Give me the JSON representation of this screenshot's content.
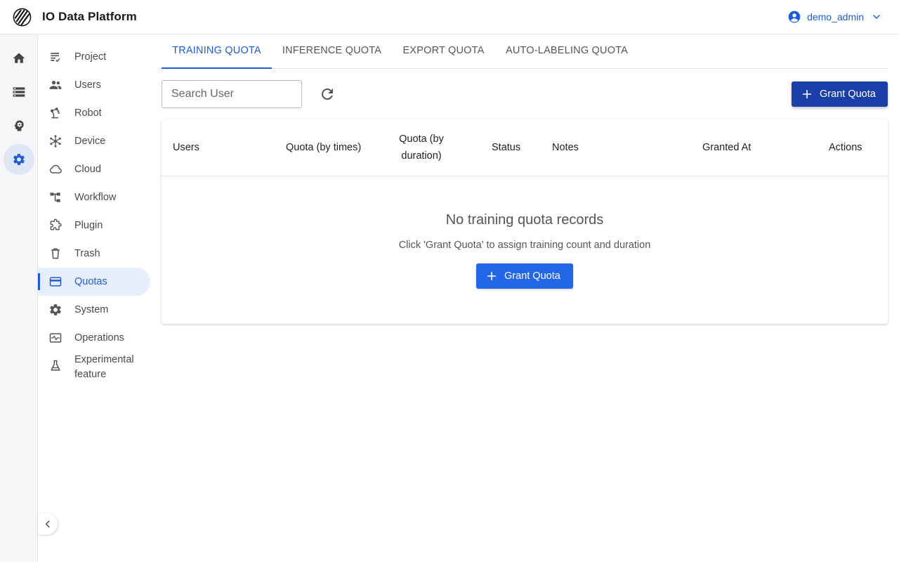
{
  "header": {
    "app_title": "IO Data Platform",
    "username": "demo_admin"
  },
  "rail": {
    "items": [
      {
        "icon": "home-icon"
      },
      {
        "icon": "storage-icon"
      },
      {
        "icon": "brain-icon"
      },
      {
        "icon": "settings-icon",
        "active": true
      }
    ]
  },
  "sidebar": {
    "items": [
      {
        "label": "Project",
        "icon": "project-icon"
      },
      {
        "label": "Users",
        "icon": "users-icon"
      },
      {
        "label": "Robot",
        "icon": "robot-arm-icon"
      },
      {
        "label": "Device",
        "icon": "device-icon"
      },
      {
        "label": "Cloud",
        "icon": "cloud-icon"
      },
      {
        "label": "Workflow",
        "icon": "workflow-icon"
      },
      {
        "label": "Plugin",
        "icon": "plugin-icon"
      },
      {
        "label": "Trash",
        "icon": "trash-icon"
      },
      {
        "label": "Quotas",
        "icon": "card-icon",
        "active": true
      },
      {
        "label": "System",
        "icon": "gear-icon"
      },
      {
        "label": "Operations",
        "icon": "operations-icon"
      },
      {
        "label": "Experimental feature",
        "icon": "flask-icon"
      }
    ]
  },
  "tabs": [
    {
      "label": "TRAINING QUOTA",
      "active": true
    },
    {
      "label": "INFERENCE QUOTA"
    },
    {
      "label": "EXPORT QUOTA"
    },
    {
      "label": "AUTO-LABELING QUOTA"
    }
  ],
  "toolbar": {
    "search_placeholder": "Search User",
    "search_value": "",
    "grant_label": "Grant Quota"
  },
  "table": {
    "columns": [
      "Users",
      "Quota (by times)",
      "Quota (by duration)",
      "Status",
      "Notes",
      "Granted At",
      "Actions"
    ],
    "rows": []
  },
  "empty_state": {
    "title": "No training quota records",
    "subtitle": "Click 'Grant Quota' to assign training count and duration",
    "button_label": "Grant Quota"
  },
  "colors": {
    "primary": "#1e5bd8",
    "primary_dark": "#1b3fa8",
    "button": "#2466e8",
    "active_bg": "#e8effc"
  }
}
